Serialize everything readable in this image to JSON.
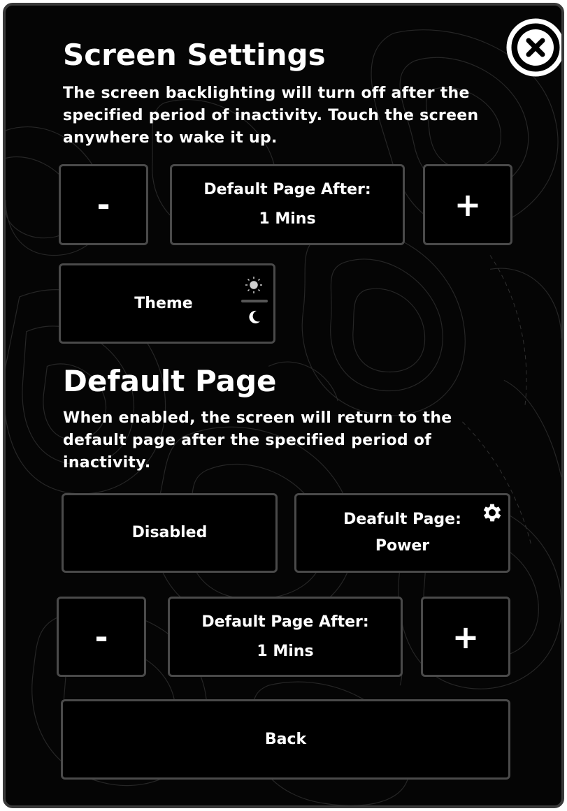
{
  "screen_settings": {
    "title": "Screen Settings",
    "description": "The screen backlighting will turn off after the specified period of inactivity. Touch the screen anywhere to wake it up.",
    "decrement_label": "-",
    "timeout": {
      "label": "Default Page After:",
      "value": "1 Mins"
    },
    "increment_label": "+",
    "theme_label": "Theme"
  },
  "default_page": {
    "title": "Default Page",
    "description": "When enabled, the screen will return to the default page after the specified period of inactivity.",
    "enable_toggle_label": "Disabled",
    "page_select": {
      "label": "Deafult Page:",
      "value": "Power"
    },
    "decrement_label": "-",
    "timeout": {
      "label": "Default Page After:",
      "value": "1 Mins"
    },
    "increment_label": "+"
  },
  "back_label": "Back",
  "colors": {
    "background": "#050505",
    "button_border": "#4a4a4a",
    "text": "#ffffff"
  },
  "icons": {
    "close": "close-icon",
    "theme_light": "sun-icon",
    "theme_dark": "moon-icon",
    "settings": "gear-icon"
  }
}
